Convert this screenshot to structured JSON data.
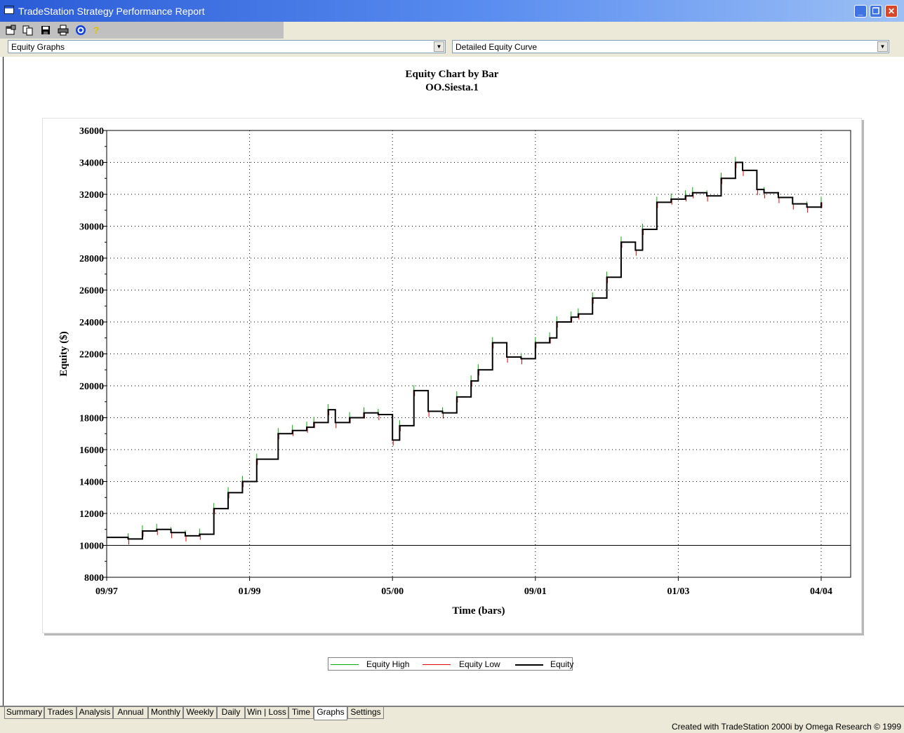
{
  "window": {
    "title": "TradeStation Strategy Performance Report",
    "minimize_label": "_",
    "restore_label": "❐",
    "close_label": "✕"
  },
  "toolbar": {
    "icons": [
      "properties-icon",
      "copy-icon",
      "save-icon",
      "print-icon",
      "target-icon",
      "help-icon"
    ]
  },
  "selectors": {
    "left": {
      "value": "Equity Graphs"
    },
    "right": {
      "value": "Detailed Equity Curve"
    }
  },
  "chart_title": {
    "line1": "Equity Chart by Bar",
    "line2": "OO.Siesta.1"
  },
  "chart_data": {
    "type": "line",
    "title": "Equity Chart by Bar",
    "subtitle": "OO.Siesta.1",
    "xlabel": "Time (bars)",
    "ylabel": "Equity ($)",
    "ylim": [
      8000,
      36000
    ],
    "y_ticks": [
      "36000",
      "34000",
      "32000",
      "30000",
      "28000",
      "26000",
      "24000",
      "22000",
      "20000",
      "18000",
      "16000",
      "14000",
      "12000",
      "10000",
      "8000"
    ],
    "x_ticks": [
      "09/97",
      "01/99",
      "05/00",
      "09/01",
      "01/03",
      "04/04"
    ],
    "grid": true,
    "baseline": 10000,
    "x_range": [
      0,
      100
    ],
    "series": [
      {
        "name": "Equity",
        "color": "#000000",
        "x": [
          0,
          3,
          5,
          7,
          9,
          11,
          13,
          15,
          17,
          19,
          21,
          24,
          26,
          28,
          29,
          31,
          32,
          34,
          36,
          38,
          40,
          41,
          43,
          45,
          47,
          49,
          51,
          52,
          54,
          56,
          58,
          60,
          62,
          63,
          65,
          66,
          68,
          70,
          72,
          74,
          75,
          77,
          79,
          81,
          82,
          84,
          86,
          88,
          89,
          91,
          92,
          94,
          96,
          98,
          100
        ],
        "values": [
          10500,
          10400,
          10900,
          11000,
          10800,
          10600,
          10700,
          12300,
          13300,
          14000,
          15400,
          17000,
          17200,
          17400,
          17700,
          18500,
          17700,
          18000,
          18300,
          18200,
          16600,
          17500,
          19700,
          18400,
          18300,
          19300,
          20300,
          21000,
          22700,
          21800,
          21700,
          22700,
          23000,
          24000,
          24300,
          24500,
          25500,
          26800,
          29000,
          28500,
          29800,
          31500,
          31700,
          31900,
          32100,
          31900,
          33000,
          34000,
          33500,
          32300,
          32100,
          31800,
          31400,
          31200,
          31500
        ]
      },
      {
        "name": "Equity High",
        "color": "#00b000"
      },
      {
        "name": "Equity Low",
        "color": "#e00000"
      }
    ],
    "legend": "bottom"
  },
  "legend": {
    "equity_high": "Equity High",
    "equity_low": "Equity Low",
    "equity": "Equity"
  },
  "tabs": [
    "Summary",
    "Trades",
    "Analysis",
    "Annual",
    "Monthly",
    "Weekly",
    "Daily",
    "Win | Loss",
    "Time",
    "Graphs",
    "Settings"
  ],
  "active_tab": "Graphs",
  "credit": "Created with TradeStation 2000i by Omega Research © 1999"
}
